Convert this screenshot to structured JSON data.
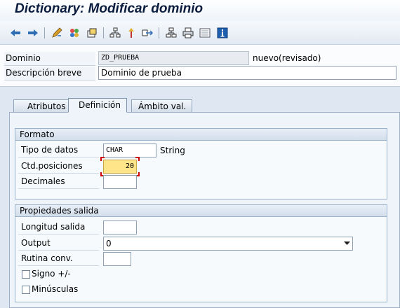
{
  "title": "Dictionary: Modificar dominio",
  "toolbar": {
    "icons": [
      "back-arrow-icon",
      "forward-arrow-icon",
      "edit-pencil-icon",
      "activate-icon",
      "other-object-icon",
      "where-used-icon",
      "change-icon",
      "navigation-icon",
      "hierarchy-icon",
      "print-icon",
      "display-object-list-icon",
      "info-icon"
    ]
  },
  "header": {
    "dominio_label": "Dominio",
    "dominio_value": "ZD_PRUEBA",
    "status": "nuevo(revisado)",
    "descripcion_label": "Descripción breve",
    "descripcion_value": "Dominio de prueba"
  },
  "tabs": [
    "Atributos",
    "Definición",
    "Ámbito val."
  ],
  "formato": {
    "title": "Formato",
    "tipo_label": "Tipo de datos",
    "tipo_value": "CHAR",
    "tipo_desc": "String",
    "ctd_label": "Ctd.posiciones",
    "ctd_value": "20",
    "decimales_label": "Decimales",
    "decimales_value": ""
  },
  "propiedades": {
    "title": "Propiedades salida",
    "longitud_label": "Longitud salida",
    "longitud_value": "",
    "output_label": "Output",
    "output_value": "0",
    "rutina_label": "Rutina conv.",
    "rutina_value": "",
    "signo_label": "Signo +/-",
    "minusculas_label": "Minúsculas"
  },
  "colors": {
    "accent": "#0b1d3e",
    "highlight_field": "#ffe58a",
    "focus_marker": "#cc0000"
  }
}
